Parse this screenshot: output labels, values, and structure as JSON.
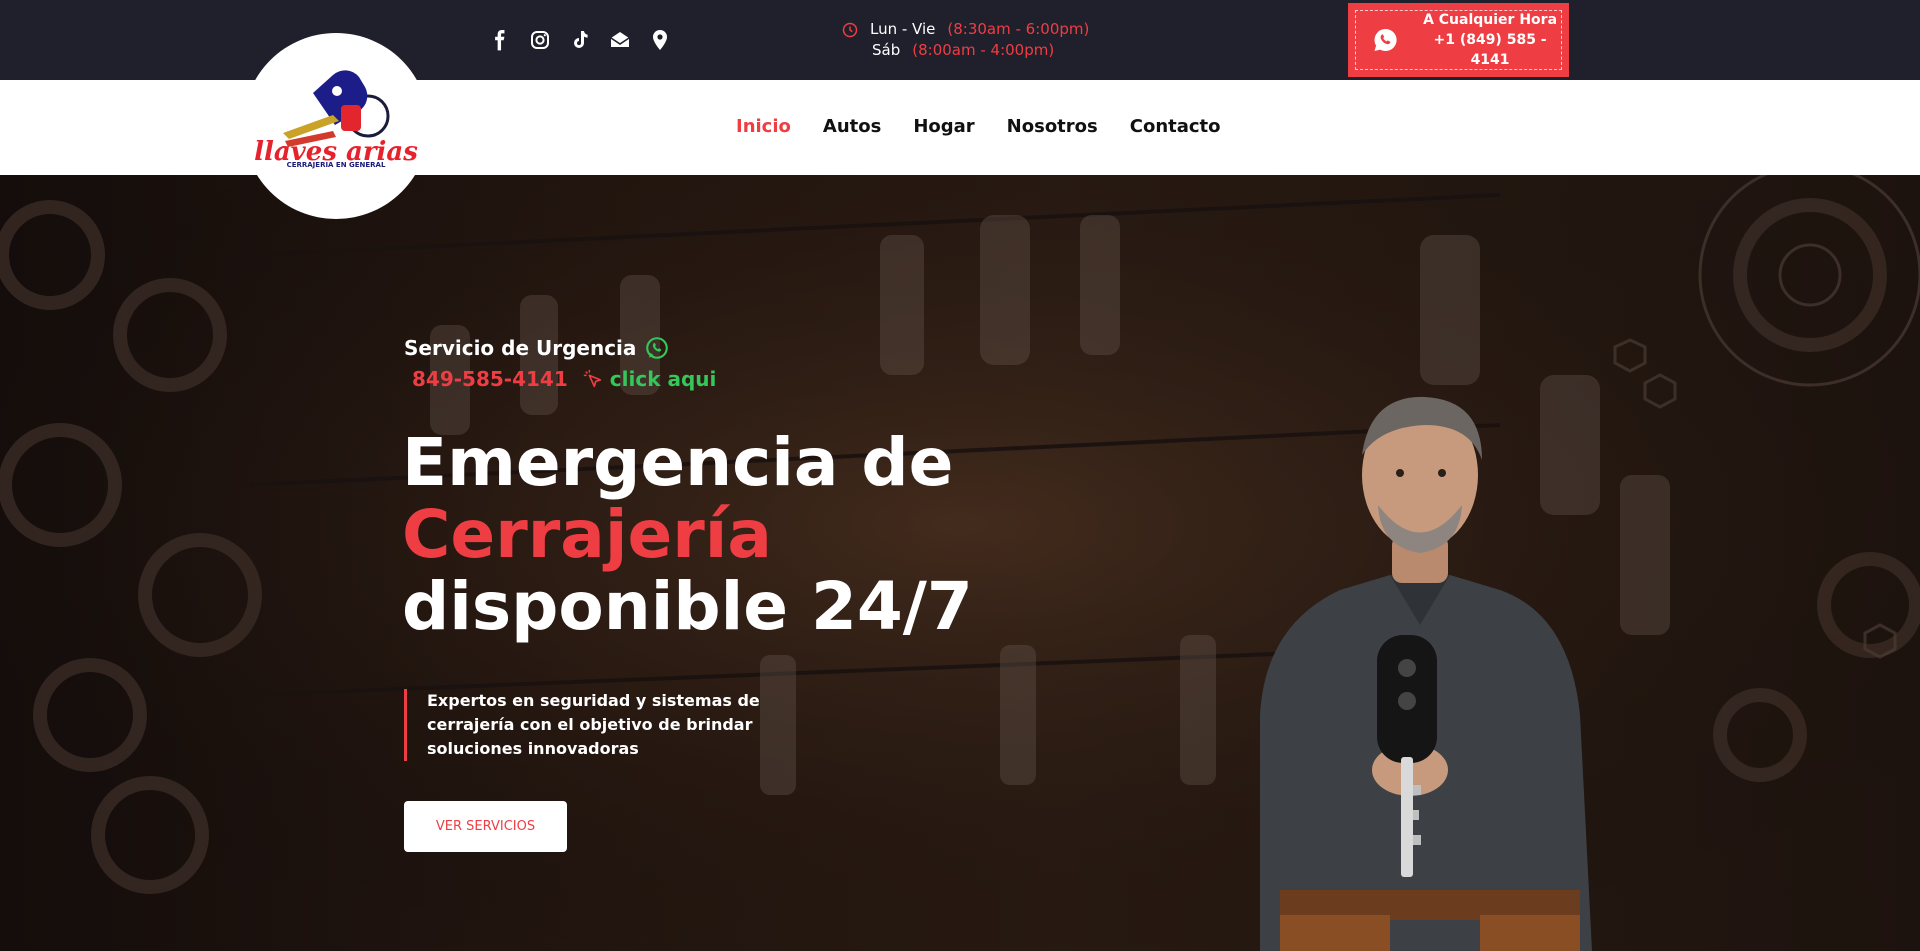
{
  "topbar": {
    "social_icons": [
      "facebook-icon",
      "instagram-icon",
      "tiktok-icon",
      "email-icon",
      "location-icon"
    ],
    "hours": {
      "row1_day": "Lun - Vie",
      "row1_time": "(8:30am - 6:00pm)",
      "row2_day": "Sáb",
      "row2_time": "(8:00am - 4:00pm)"
    },
    "call": {
      "line1": "A Cualquier Hora",
      "line2": "+1 (849) 585 - 4141"
    }
  },
  "logo": {
    "brand": "llaves arias",
    "tagline": "CERRAJERIA EN GENERAL"
  },
  "nav": {
    "items": [
      "Inicio",
      "Autos",
      "Hogar",
      "Nosotros",
      "Contacto"
    ],
    "active": "Inicio"
  },
  "hero": {
    "urgent_label": "Servicio de Urgencia",
    "phone": "849-585-4141",
    "click_label": "click aqui",
    "title_line1": "Emergencia de",
    "title_line2": "Cerrajería",
    "title_line3": "disponible 24/7",
    "description": "Expertos en seguridad y sistemas de cerrajería con el objetivo de brindar soluciones innovadoras",
    "button": "VER SERVICIOS"
  },
  "colors": {
    "accent": "#ee3e43",
    "topbar": "#1f202c",
    "whatsapp_green": "#34c759"
  }
}
